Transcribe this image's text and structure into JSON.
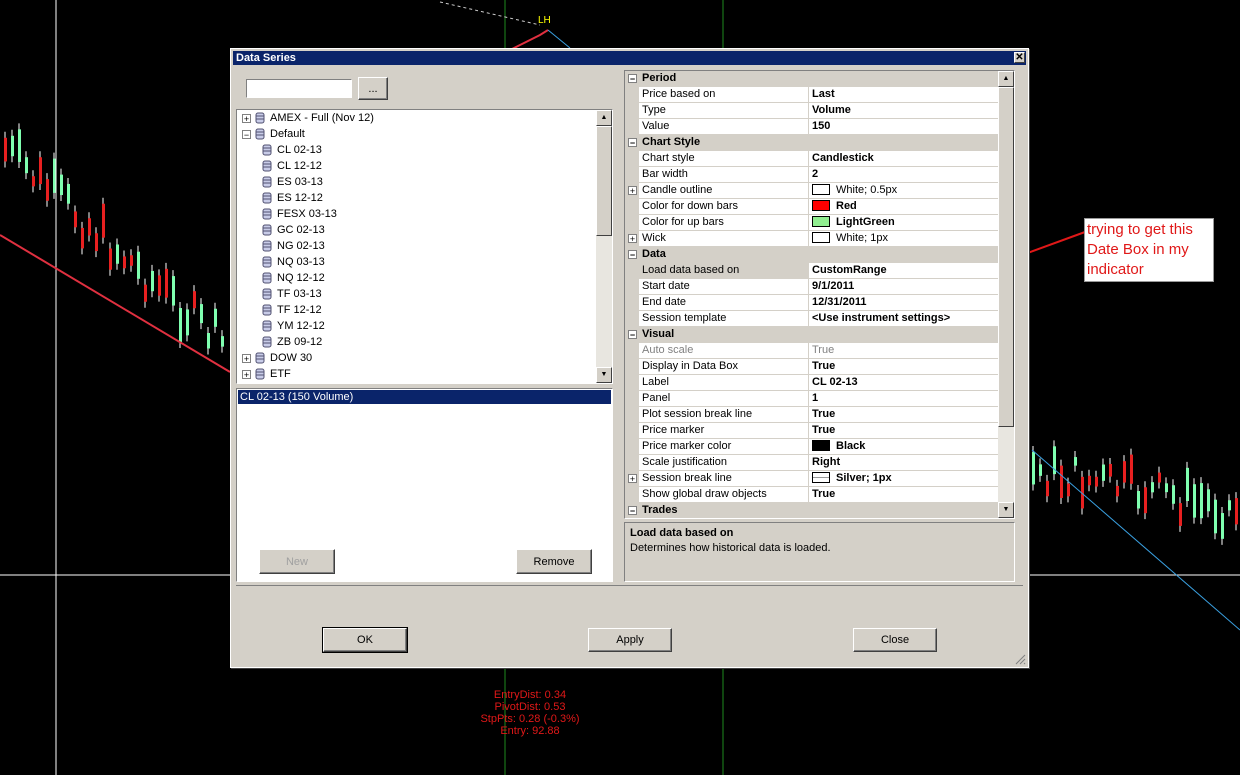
{
  "chart": {
    "pivot_label": "LH",
    "readout": [
      "EntryDist: 0.34",
      "PivotDist: 0.53",
      "StpPts: 0.28 (-0.3%)",
      "Entry: 92.88"
    ],
    "annotation": "trying to get this Date Box in my indicator",
    "colors": {
      "up": "#7fffb0",
      "down": "#e82020",
      "trend": "#e03040",
      "channel": "#3aa0e0",
      "arrow": "#e01818"
    }
  },
  "dialog": {
    "title": "Data Series",
    "search": {
      "value": "",
      "browse_label": "..."
    },
    "tree": [
      {
        "label": "AMEX - Full (Nov 12)",
        "level": 0,
        "expander": "+"
      },
      {
        "label": "Default",
        "level": 0,
        "expander": "−"
      },
      {
        "label": "CL 02-13",
        "level": 1
      },
      {
        "label": "CL 12-12",
        "level": 1
      },
      {
        "label": "ES 03-13",
        "level": 1
      },
      {
        "label": "ES 12-12",
        "level": 1
      },
      {
        "label": "FESX 03-13",
        "level": 1
      },
      {
        "label": "GC 02-13",
        "level": 1
      },
      {
        "label": "NG 02-13",
        "level": 1
      },
      {
        "label": "NQ 03-13",
        "level": 1
      },
      {
        "label": "NQ 12-12",
        "level": 1
      },
      {
        "label": "TF 03-13",
        "level": 1
      },
      {
        "label": "TF 12-12",
        "level": 1
      },
      {
        "label": "YM 12-12",
        "level": 1
      },
      {
        "label": "ZB 09-12",
        "level": 1
      },
      {
        "label": "DOW 30",
        "level": 0,
        "expander": "+"
      },
      {
        "label": "ETF",
        "level": 0,
        "expander": "+"
      }
    ],
    "selected_series": "CL 02-13 (150 Volume)",
    "new_label": "New",
    "remove_label": "Remove",
    "ok_label": "OK",
    "apply_label": "Apply",
    "close_label": "Close",
    "grid": [
      {
        "kind": "cat",
        "name": "Period"
      },
      {
        "kind": "prop",
        "name": "Price based on",
        "value": "Last"
      },
      {
        "kind": "prop",
        "name": "Type",
        "value": "Volume"
      },
      {
        "kind": "prop",
        "name": "Value",
        "value": "150"
      },
      {
        "kind": "cat",
        "name": "Chart Style"
      },
      {
        "kind": "prop",
        "name": "Chart style",
        "value": "Candlestick"
      },
      {
        "kind": "prop",
        "name": "Bar width",
        "value": "2"
      },
      {
        "kind": "prop",
        "name": "Candle outline",
        "value": "White; 0.5px",
        "swatch": "#ffffff",
        "expander": true,
        "plain": true
      },
      {
        "kind": "prop",
        "name": "Color for down bars",
        "value": "Red",
        "swatch": "#ff0000"
      },
      {
        "kind": "prop",
        "name": "Color for up bars",
        "value": "LightGreen",
        "swatch": "#90ee90"
      },
      {
        "kind": "prop",
        "name": "Wick",
        "value": "White; 1px",
        "swatch": "#ffffff",
        "expander": true,
        "plain": true
      },
      {
        "kind": "cat",
        "name": "Data"
      },
      {
        "kind": "prop",
        "name": "Load data based on",
        "value": "CustomRange",
        "selected": true
      },
      {
        "kind": "prop",
        "name": "Start date",
        "value": "9/1/2011"
      },
      {
        "kind": "prop",
        "name": "End date",
        "value": "12/31/2011"
      },
      {
        "kind": "prop",
        "name": "Session template",
        "value": "<Use instrument settings>"
      },
      {
        "kind": "cat",
        "name": "Visual"
      },
      {
        "kind": "prop",
        "name": "Auto scale",
        "value": "True",
        "grey": true
      },
      {
        "kind": "prop",
        "name": "Display in Data Box",
        "value": "True"
      },
      {
        "kind": "prop",
        "name": "Label",
        "value": "CL 02-13"
      },
      {
        "kind": "prop",
        "name": "Panel",
        "value": "1"
      },
      {
        "kind": "prop",
        "name": "Plot session break line",
        "value": "True"
      },
      {
        "kind": "prop",
        "name": "Price marker",
        "value": "True"
      },
      {
        "kind": "prop",
        "name": "Price marker color",
        "value": "Black",
        "swatch": "#000000"
      },
      {
        "kind": "prop",
        "name": "Scale justification",
        "value": "Right"
      },
      {
        "kind": "prop",
        "name": "Session break line",
        "value": "Silver; 1px",
        "swatch": "#ffffff",
        "expander": true,
        "dashed": true
      },
      {
        "kind": "prop",
        "name": "Show global draw objects",
        "value": "True"
      },
      {
        "kind": "cat",
        "name": "Trades"
      }
    ],
    "description": {
      "title": "Load data based on",
      "text": "Determines how historical data is loaded."
    }
  }
}
